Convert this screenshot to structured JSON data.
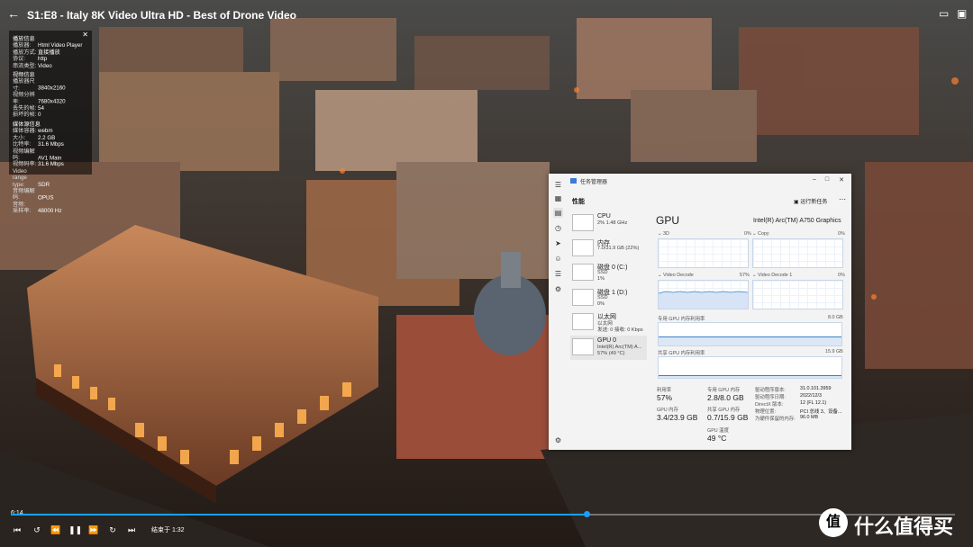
{
  "player": {
    "title": "S1:E8 - Italy 8K Video Ultra HD - Best of Drone Video",
    "current_time": "6:14",
    "end_label": "结束于 1:32",
    "progress": 0.61
  },
  "info_panel": {
    "sections": [
      {
        "title": "播放信息",
        "rows": [
          {
            "k": "播放器:",
            "v": "Html Video Player"
          },
          {
            "k": "播放方式:",
            "v": "直接播放"
          },
          {
            "k": "协议:",
            "v": "http"
          },
          {
            "k": "串流类型:",
            "v": "Video"
          }
        ]
      },
      {
        "title": "视频信息",
        "rows": [
          {
            "k": "播放器尺寸:",
            "v": "3840x2160"
          },
          {
            "k": "视频分辨率:",
            "v": "7680x4320"
          },
          {
            "k": "丢失的帧:",
            "v": "54"
          },
          {
            "k": "损坏的帧:",
            "v": "0"
          }
        ]
      },
      {
        "title": "媒体源信息",
        "rows": [
          {
            "k": "媒体容器:",
            "v": "webm"
          },
          {
            "k": "大小:",
            "v": "2.2 GB"
          },
          {
            "k": "比特率:",
            "v": "31.6 Mbps"
          },
          {
            "k": "视频编解码:",
            "v": "AV1 Main"
          },
          {
            "k": "视频码率:",
            "v": "31.6 Mbps"
          },
          {
            "k": "Video range type:",
            "v": "SDR"
          },
          {
            "k": "音频编解码:",
            "v": "OPUS"
          },
          {
            "k": "音频:",
            "v": ""
          },
          {
            "k": "采样率:",
            "v": "48000 Hz"
          }
        ]
      }
    ]
  },
  "watermark": {
    "logo": "值",
    "text": "什么值得买"
  },
  "taskmgr": {
    "window_title": "任务管理器",
    "header": "性能",
    "run_task": "运行新任务",
    "devices": [
      {
        "name": "CPU",
        "sub": "2% 1.48 GHz",
        "sub2": ""
      },
      {
        "name": "内存",
        "sub": "7.0/31.9 GB (22%)",
        "sub2": ""
      },
      {
        "name": "磁盘 0 (C:)",
        "sub": "SSD",
        "sub2": "1%"
      },
      {
        "name": "磁盘 1 (D:)",
        "sub": "SSD",
        "sub2": "0%"
      },
      {
        "name": "以太网",
        "sub": "以太网",
        "sub2": "发送: 0 接收: 0 Kbps"
      },
      {
        "name": "GPU 0",
        "sub": "Intel(R) Arc(TM) A...",
        "sub2": "57% (49 °C)"
      }
    ],
    "gpu": {
      "title": "GPU",
      "model": "Intel(R) Arc(TM) A750 Graphics",
      "graphs": [
        {
          "label": "3D",
          "pct": "0%"
        },
        {
          "label": "Copy",
          "pct": "0%"
        },
        {
          "label": "Video Decode",
          "pct": "57%"
        },
        {
          "label": "Video Decode 1",
          "pct": "0%"
        }
      ],
      "dedicated_mem_label": "专用 GPU 内存利用率",
      "dedicated_mem_max": "8.0 GB",
      "shared_mem_label": "共享 GPU 内存利用率",
      "shared_mem_max": "15.9 GB",
      "stats": {
        "util_k": "利用率",
        "util_v": "57%",
        "ded_k": "专用 GPU 内存",
        "ded_v": "2.8/8.0 GB",
        "gpumem_k": "GPU 内存",
        "gpumem_v": "3.4/23.9 GB",
        "shared_k": "共享 GPU 内存",
        "shared_v": "0.7/15.9 GB",
        "temp_k": "GPU 温度",
        "temp_v": "49 °C"
      },
      "details": [
        {
          "k": "驱动程序版本:",
          "v": "31.0.101.3959"
        },
        {
          "k": "驱动程序日期:",
          "v": "2022/12/3"
        },
        {
          "k": "DirectX 版本:",
          "v": "12 (FL 12.1)"
        },
        {
          "k": "物理位置:",
          "v": "PCI 总线 3、设备..."
        },
        {
          "k": "为硬件保留的内存:",
          "v": "96.0 MB"
        }
      ]
    }
  }
}
